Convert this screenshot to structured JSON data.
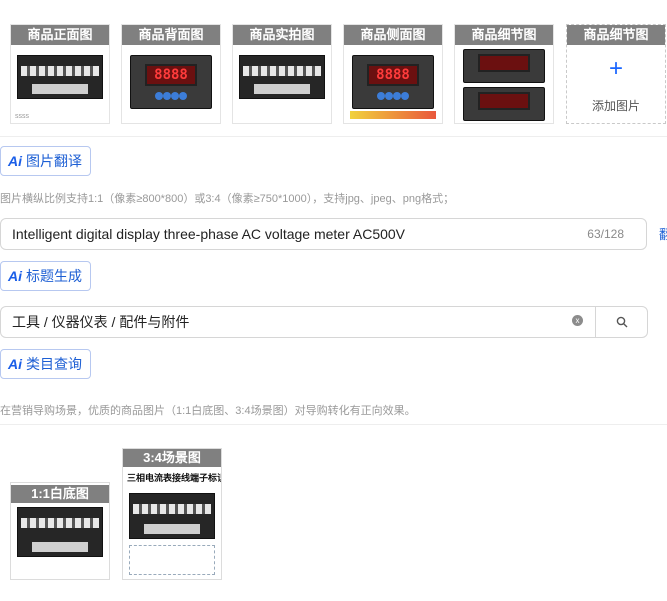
{
  "product_images": [
    {
      "label": "商品正面图",
      "kind": "front"
    },
    {
      "label": "商品背面图",
      "kind": "back"
    },
    {
      "label": "商品实拍图",
      "kind": "real"
    },
    {
      "label": "商品侧面图",
      "kind": "side"
    },
    {
      "label": "商品细节图",
      "kind": "detail"
    }
  ],
  "add_image": {
    "label": "商品细节图",
    "plus": "+",
    "text": "添加图片"
  },
  "image_translate_button": {
    "ai": "Ai",
    "label": "图片翻译"
  },
  "image_hint": "图片横纵比例支持1:1（像素≥800*800）或3:4（像素≥750*1000），支持jpg、jpeg、png格式；",
  "title_input": {
    "value": "Intelligent digital display three-phase AC voltage meter AC500V",
    "counter": "63/128"
  },
  "side_link_char": "翻",
  "title_generate_button": {
    "ai": "Ai",
    "label": "标题生成"
  },
  "category_input": {
    "value": "工具 / 仪器仪表 / 配件与附件",
    "clear_icon": "x"
  },
  "category_query_button": {
    "ai": "Ai",
    "label": "类目查询"
  },
  "scene_hint": "在营销导购场景，优质的商品图片（1:1白底图、3:4场景图）对导购转化有正向效果。",
  "scene_images": [
    {
      "label": "1:1白底图"
    },
    {
      "label": "3:4场景图",
      "caption": "三相电流表接线端子标识图"
    }
  ]
}
